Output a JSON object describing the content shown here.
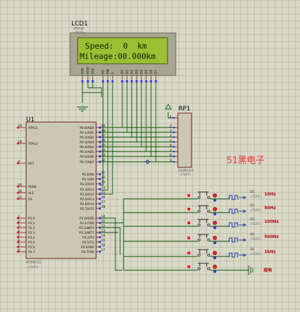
{
  "lcd": {
    "ref": "LCD1",
    "part": "LM016L",
    "text_tag": "<TEXT>",
    "line1": " Speed:  0  km",
    "line2": "Mileage:00.000km",
    "pins": [
      "VSS",
      "VDD",
      "VEE",
      "RS",
      "RW",
      "E",
      "D0",
      "D1",
      "D2",
      "D3",
      "D4",
      "D5",
      "D6",
      "D7"
    ],
    "colors": {
      "screen": "#9bbf32",
      "frame": "#a8a68e"
    }
  },
  "mcu": {
    "ref": "U1",
    "part": "AT89C51",
    "text_tag": "<TEXT>",
    "left_pins": [
      {
        "num": "19",
        "name": "XTAL1"
      },
      {
        "num": "18",
        "name": "XTAL2"
      },
      {
        "num": "9",
        "name": "RST"
      },
      {
        "num": "29",
        "name": "PSEN"
      },
      {
        "num": "30",
        "name": "ALE"
      },
      {
        "num": "31",
        "name": "EA"
      },
      {
        "num": "1",
        "name": "P1.0"
      },
      {
        "num": "2",
        "name": "P1.1"
      },
      {
        "num": "3",
        "name": "P1.2"
      },
      {
        "num": "4",
        "name": "P1.3"
      },
      {
        "num": "5",
        "name": "P1.4"
      },
      {
        "num": "6",
        "name": "P1.5"
      },
      {
        "num": "7",
        "name": "P1.6"
      },
      {
        "num": "8",
        "name": "P1.7"
      }
    ],
    "right_pins": [
      {
        "num": "39",
        "name": "P0.0/AD0"
      },
      {
        "num": "38",
        "name": "P0.1/AD1"
      },
      {
        "num": "37",
        "name": "P0.2/AD2"
      },
      {
        "num": "36",
        "name": "P0.3/AD3"
      },
      {
        "num": "35",
        "name": "P0.4/AD4"
      },
      {
        "num": "34",
        "name": "P0.5/AD5"
      },
      {
        "num": "33",
        "name": "P0.6/AD6"
      },
      {
        "num": "32",
        "name": "P0.7/AD7"
      },
      {
        "num": "21",
        "name": "P2.0/A8"
      },
      {
        "num": "22",
        "name": "P2.1/A9"
      },
      {
        "num": "23",
        "name": "P2.2/A10"
      },
      {
        "num": "24",
        "name": "P2.3/A11"
      },
      {
        "num": "25",
        "name": "P2.4/A12"
      },
      {
        "num": "26",
        "name": "P2.5/A13"
      },
      {
        "num": "27",
        "name": "P2.6/A14"
      },
      {
        "num": "28",
        "name": "P2.7/A15"
      },
      {
        "num": "10",
        "name": "P3.0/RXD"
      },
      {
        "num": "11",
        "name": "P3.1/TXD"
      },
      {
        "num": "12",
        "name": "P3.2/INT0"
      },
      {
        "num": "13",
        "name": "P3.3/INT1"
      },
      {
        "num": "14",
        "name": "P3.4/T0"
      },
      {
        "num": "15",
        "name": "P3.5/T1"
      },
      {
        "num": "16",
        "name": "P3.6/WR"
      },
      {
        "num": "17",
        "name": "P3.7/RD"
      }
    ]
  },
  "respack": {
    "ref": "RP1",
    "part": "RESPACK-8",
    "text_tag": "<TEXT>",
    "pins": [
      "1",
      "2",
      "3",
      "4",
      "5",
      "6",
      "7",
      "8",
      "9"
    ]
  },
  "brand": "51黑电子",
  "switch_rows": [
    {
      "label": "10Hz",
      "source_num": "(2)",
      "source_tag": "<TEXT>"
    },
    {
      "label": "50Hz",
      "source_num": "(2)",
      "source_tag": "<TEXT>"
    },
    {
      "label": "100Hz",
      "source_num": "(2)",
      "source_tag": "<TEXT>"
    },
    {
      "label": "500Hz",
      "source_num": "(2)",
      "source_tag": "<TEXT>"
    },
    {
      "label": "1kHz",
      "source_num": "(2)",
      "source_tag": "<TEXT>"
    },
    {
      "label": "接地",
      "source_num": "",
      "source_tag": ""
    }
  ],
  "colors": {
    "wire": "#005500",
    "component_border": "#6b1b1b",
    "pin_text": "#000000",
    "frequency_label": "#b00000",
    "brand": "#ee3333"
  }
}
